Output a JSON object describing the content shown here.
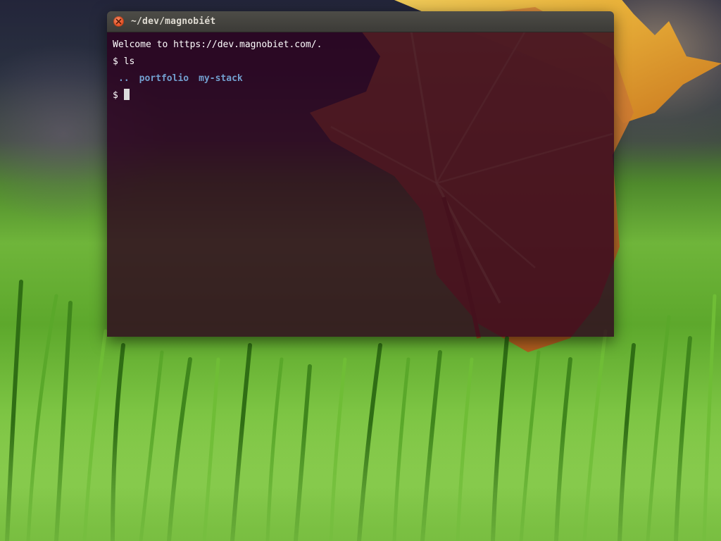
{
  "window": {
    "title": "~/dev/magnobiét",
    "close_icon": "close-icon"
  },
  "terminal": {
    "welcome_line": "Welcome to https://dev.magnobiet.com/.",
    "prompt_symbol": "$",
    "command": "ls",
    "listing": [
      "..",
      "portfolio",
      "my-stack"
    ],
    "current_input": ""
  },
  "colors": {
    "terminal_background": "#2c001e",
    "directory_text": "#729fcf",
    "close_button": "#e8572b",
    "titlebar": "#3c3b37"
  }
}
